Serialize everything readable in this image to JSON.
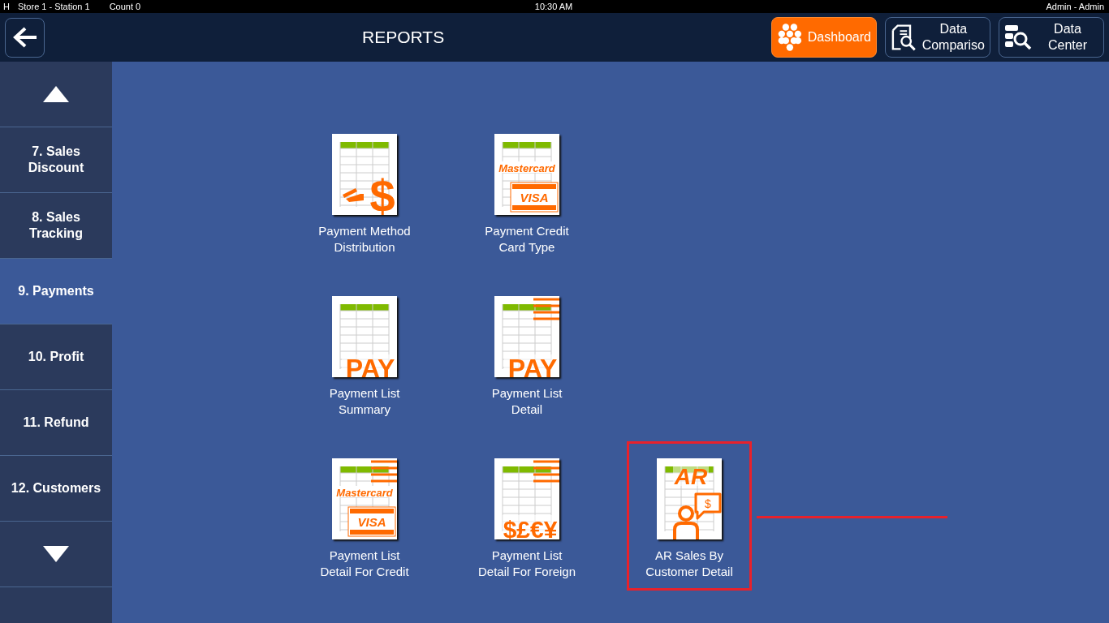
{
  "status_bar": {
    "mode": "H",
    "station": "Store 1 - Station 1",
    "count": "Count 0",
    "time": "10:30 AM",
    "user": "Admin - Admin"
  },
  "header": {
    "title": "REPORTS",
    "buttons": [
      {
        "label": "Dashboard",
        "kind": "dashboard",
        "selected": true
      },
      {
        "label": "Data Compariso",
        "kind": "comparison",
        "selected": false
      },
      {
        "label": "Data Center",
        "kind": "center",
        "selected": false
      }
    ]
  },
  "sidebar": {
    "items": [
      {
        "label": "7. Sales Discount",
        "selected": false
      },
      {
        "label": "8. Sales Tracking",
        "selected": false
      },
      {
        "label": "9. Payments",
        "selected": true
      },
      {
        "label": "10. Profit",
        "selected": false
      },
      {
        "label": "11. Refund",
        "selected": false
      },
      {
        "label": "12. Customers",
        "selected": false
      }
    ]
  },
  "report_rows": [
    [
      {
        "label": "Payment Method Distribution",
        "kind": "method",
        "icon_texts": [
          "$"
        ],
        "highlighted": false
      },
      {
        "label": "Payment Credit Card Type",
        "kind": "cards",
        "icon_texts": [
          "Mastercard",
          "VISA"
        ],
        "highlighted": false
      }
    ],
    [
      {
        "label": "Payment List Summary",
        "kind": "pay",
        "icon_texts": [
          "PAY"
        ],
        "highlighted": false
      },
      {
        "label": "Payment List Detail",
        "kind": "paydetail",
        "icon_texts": [
          "PAY"
        ],
        "highlighted": false
      }
    ],
    [
      {
        "label": "Payment List Detail For Credit",
        "kind": "credit",
        "icon_texts": [
          "Mastercard",
          "VISA"
        ],
        "highlighted": false
      },
      {
        "label": "Payment List Detail For Foreign",
        "kind": "foreign",
        "icon_texts": [
          "$£€¥"
        ],
        "highlighted": false
      },
      {
        "label": "AR Sales By Customer Detail",
        "kind": "ar",
        "icon_texts": [
          "AR",
          "$"
        ],
        "highlighted": true
      }
    ]
  ]
}
